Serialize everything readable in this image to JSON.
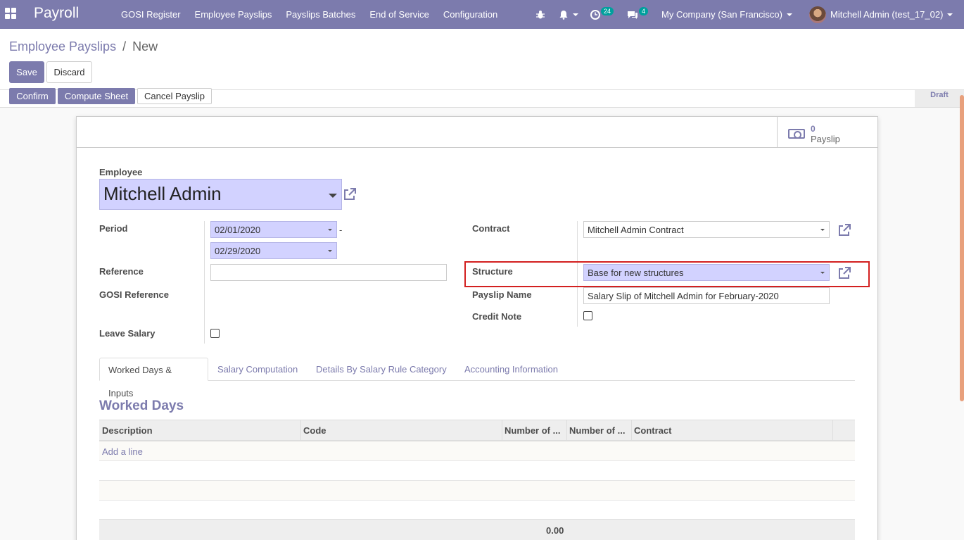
{
  "navbar": {
    "brand": "Payroll",
    "menu": [
      "GOSI Register",
      "Employee Payslips",
      "Payslips Batches",
      "End of Service",
      "Configuration"
    ],
    "activity_badge": "24",
    "messages_badge": "4",
    "company": "My Company (San Francisco)",
    "user": "Mitchell Admin (test_17_02)"
  },
  "breadcrumb": {
    "parent": "Employee Payslips",
    "separator": "/",
    "current": "New"
  },
  "control": {
    "save": "Save",
    "discard": "Discard"
  },
  "statusbar": {
    "confirm": "Confirm",
    "compute": "Compute Sheet",
    "cancel": "Cancel Payslip",
    "state": "Draft"
  },
  "smart_button": {
    "value": "0",
    "label": "Payslip"
  },
  "form": {
    "employee_label": "Employee",
    "employee_value": "Mitchell Admin",
    "period_label": "Period",
    "date_from": "02/01/2020",
    "date_sep": "-",
    "date_to": "02/29/2020",
    "reference_label": "Reference",
    "reference_value": "",
    "gosi_reference_label": "GOSI Reference",
    "leave_salary_label": "Leave Salary",
    "contract_label": "Contract",
    "contract_value": "Mitchell Admin Contract",
    "structure_label": "Structure",
    "structure_value": "Base for new structures",
    "payslip_name_label": "Payslip Name",
    "payslip_name_value": "Salary Slip of Mitchell Admin for February-2020",
    "credit_note_label": "Credit Note"
  },
  "tabs": [
    "Worked Days & Inputs",
    "Salary Computation",
    "Details By Salary Rule Category",
    "Accounting Information"
  ],
  "worked_days": {
    "title": "Worked Days",
    "columns": [
      "Description",
      "Code",
      "Number of ...",
      "Number of ...",
      "Contract"
    ],
    "add_line": "Add a line",
    "total": "0.00"
  },
  "colors": {
    "primary": "#7c7bad",
    "required_bg": "#d2d2ff",
    "highlight": "#d32020"
  }
}
